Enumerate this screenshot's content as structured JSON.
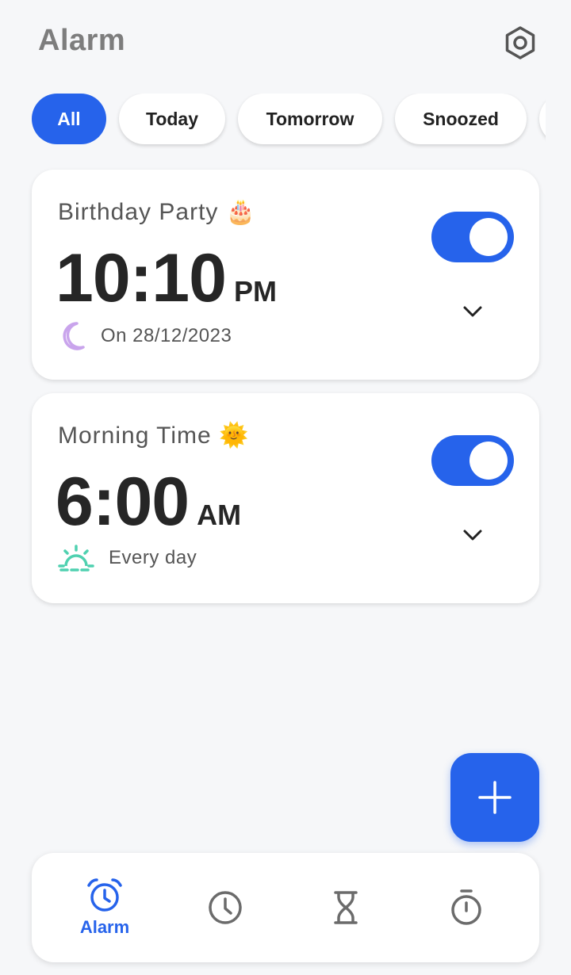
{
  "header": {
    "title": "Alarm",
    "settings_icon": "settings-hexagon-icon"
  },
  "filters": [
    {
      "label": "All",
      "active": true
    },
    {
      "label": "Today",
      "active": false
    },
    {
      "label": "Tomorrow",
      "active": false
    },
    {
      "label": "Snoozed",
      "active": false
    }
  ],
  "alarms": [
    {
      "label": "Birthday Party",
      "emoji": "🎂",
      "time": "10:10",
      "period": "PM",
      "schedule": "On 28/12/2023",
      "schedule_icon": "moon-icon",
      "enabled": true
    },
    {
      "label": "Morning Time",
      "emoji": "🌞",
      "time": "6:00",
      "period": "AM",
      "schedule": "Every day",
      "schedule_icon": "sunrise-icon",
      "enabled": true
    }
  ],
  "fab": {
    "icon": "plus-icon"
  },
  "nav": {
    "items": [
      {
        "label": "Alarm",
        "icon": "alarm-clock-icon",
        "active": true
      },
      {
        "label": "",
        "icon": "clock-icon",
        "active": false
      },
      {
        "label": "",
        "icon": "hourglass-icon",
        "active": false
      },
      {
        "label": "",
        "icon": "stopwatch-icon",
        "active": false
      }
    ]
  },
  "colors": {
    "accent": "#2663eb",
    "background": "#f6f7f9",
    "moon": "#c9a4ec",
    "sunrise": "#4fd1b0",
    "icon_gray": "#6b6b6b"
  }
}
